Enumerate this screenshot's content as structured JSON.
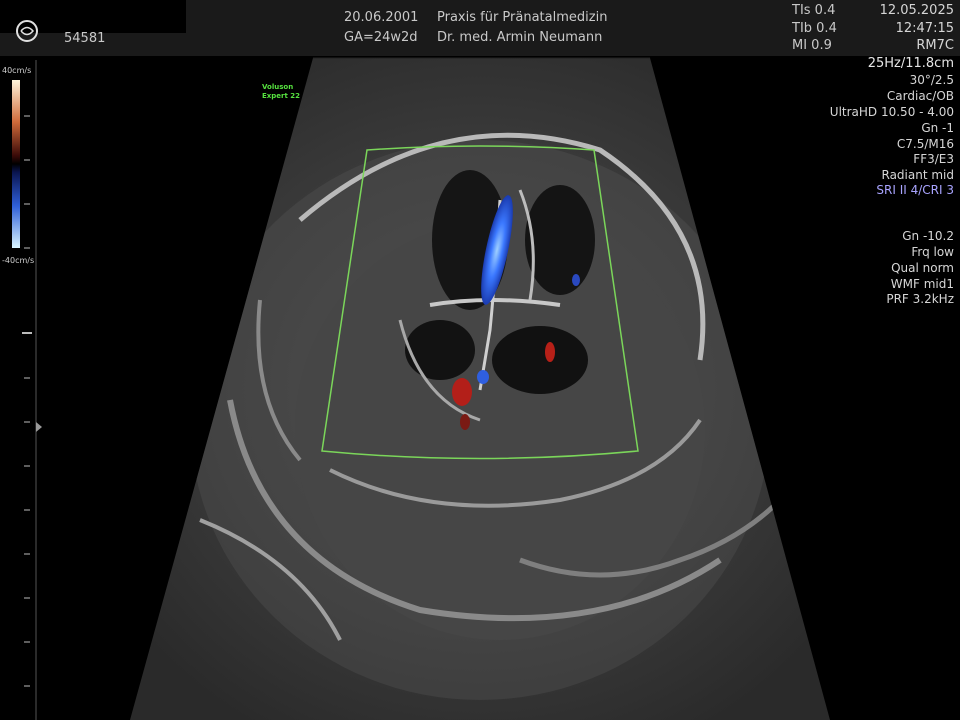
{
  "header": {
    "patient_id": "54581",
    "date": "20.06.2001",
    "ga": "GA=24w2d",
    "clinic": "Praxis für Pränatalmedizin",
    "doctor": "Dr. med. Armin Neumann",
    "tis": "TIs 0.4",
    "tib": "TIb 0.4",
    "mi": "MI 0.9",
    "exam_date": "12.05.2025",
    "exam_time": "12:47:15",
    "probe": "RM7C"
  },
  "params": {
    "frame": "25Hz/11.8cm",
    "angle": "30°/2.5",
    "preset": "Cardiac/OB",
    "ultrahd": "UltraHD 10.50 - 4.00",
    "gain": "Gn  -1",
    "c": "C7.5/M16",
    "ff": "FF3/E3",
    "radiant": "Radiant mid",
    "sri": "SRI II 4/CRI 3",
    "color_gain": "Gn -10.2",
    "frq": "Frq low",
    "qual": "Qual norm",
    "wmf": "WMF mid1",
    "prf": "PRF  3.2kHz"
  },
  "color_scale": {
    "top": "40cm/s",
    "bottom": "-40cm/s"
  },
  "device": {
    "line1": "Voluson",
    "line2": "Expert 22"
  },
  "colors": {
    "roi": "#7bd65a",
    "flow_blue": "#2f6bff",
    "flow_red": "#c0231c",
    "logo": "#56e13f"
  },
  "icons": [
    "ge-logo-icon"
  ]
}
